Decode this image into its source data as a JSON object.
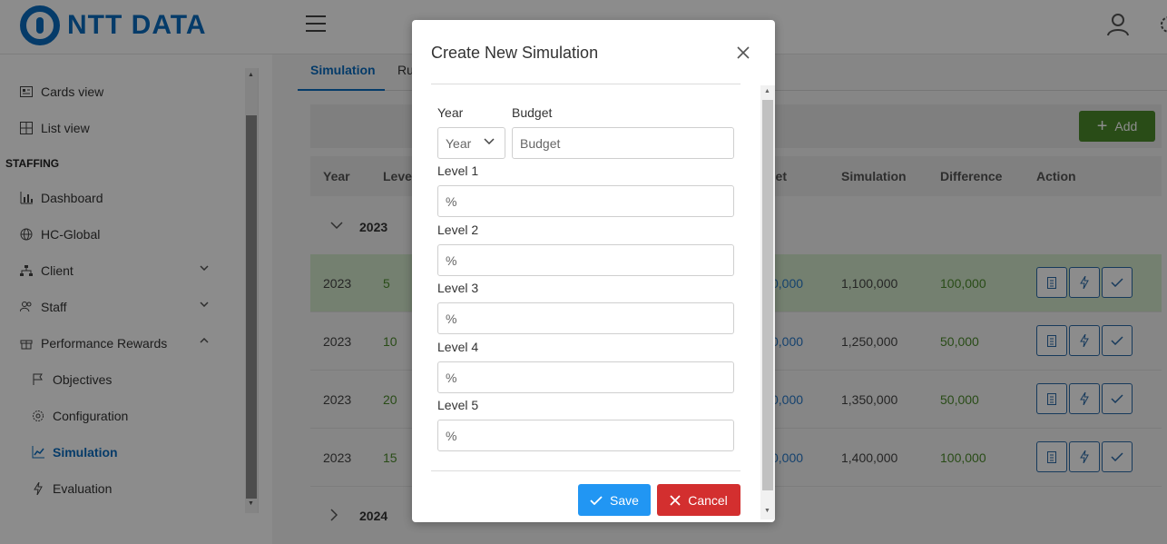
{
  "header": {
    "logo_text": "NTT DATA"
  },
  "sidebar": {
    "items_top": [
      {
        "label": "Cards view",
        "icon": "id-card-icon"
      },
      {
        "label": "List view",
        "icon": "grid-icon"
      }
    ],
    "section_label": "STAFFING",
    "items": [
      {
        "label": "Dashboard",
        "icon": "bar-chart-icon"
      },
      {
        "label": "HC-Global",
        "icon": "globe-icon"
      },
      {
        "label": "Client",
        "icon": "sitemap-icon"
      },
      {
        "label": "Staff",
        "icon": "users-icon"
      },
      {
        "label": "Performance Rewards",
        "icon": "gift-icon"
      }
    ],
    "sub_items": [
      {
        "label": "Objectives",
        "icon": "flag-icon"
      },
      {
        "label": "Configuration",
        "icon": "gear-icon"
      },
      {
        "label": "Simulation",
        "icon": "chart-line-icon",
        "active": true
      },
      {
        "label": "Evaluation",
        "icon": "bolt-icon"
      }
    ]
  },
  "tabs": [
    {
      "label": "Simulation"
    },
    {
      "label": "Ru"
    }
  ],
  "toolbar": {
    "add_label": "Add"
  },
  "table": {
    "headers": {
      "year": "Year",
      "level": "Level",
      "budget": "get",
      "simulation": "Simulation",
      "difference": "Difference",
      "action": "Action"
    },
    "groups": [
      {
        "label": "2023"
      },
      {
        "label": "2024"
      }
    ],
    "rows": [
      {
        "year": "2023",
        "level": "5",
        "budget": "0,000",
        "simulation": "1,100,000",
        "difference": "100,000"
      },
      {
        "year": "2023",
        "level": "10",
        "budget": "0,000",
        "simulation": "1,250,000",
        "difference": "50,000"
      },
      {
        "year": "2023",
        "level": "20",
        "budget": "0,000",
        "simulation": "1,350,000",
        "difference": "50,000"
      },
      {
        "year": "2023",
        "level": "15",
        "budget": "0,000",
        "simulation": "1,400,000",
        "difference": "100,000"
      }
    ]
  },
  "modal": {
    "title": "Create New Simulation",
    "year_label": "Year",
    "year_value": "Year",
    "budget_label": "Budget",
    "budget_placeholder": "Budget",
    "levels": [
      {
        "label": "Level 1",
        "placeholder": "%"
      },
      {
        "label": "Level 2",
        "placeholder": "%"
      },
      {
        "label": "Level 3",
        "placeholder": "%"
      },
      {
        "label": "Level 4",
        "placeholder": "%"
      },
      {
        "label": "Level 5",
        "placeholder": "%"
      }
    ],
    "save_label": "Save",
    "cancel_label": "Cancel"
  },
  "colors": {
    "brand": "#0a6cbf",
    "add": "#4b8a2b",
    "save": "#2196f3",
    "cancel": "#d32f2f",
    "row_selected": "#d3e9cc"
  }
}
